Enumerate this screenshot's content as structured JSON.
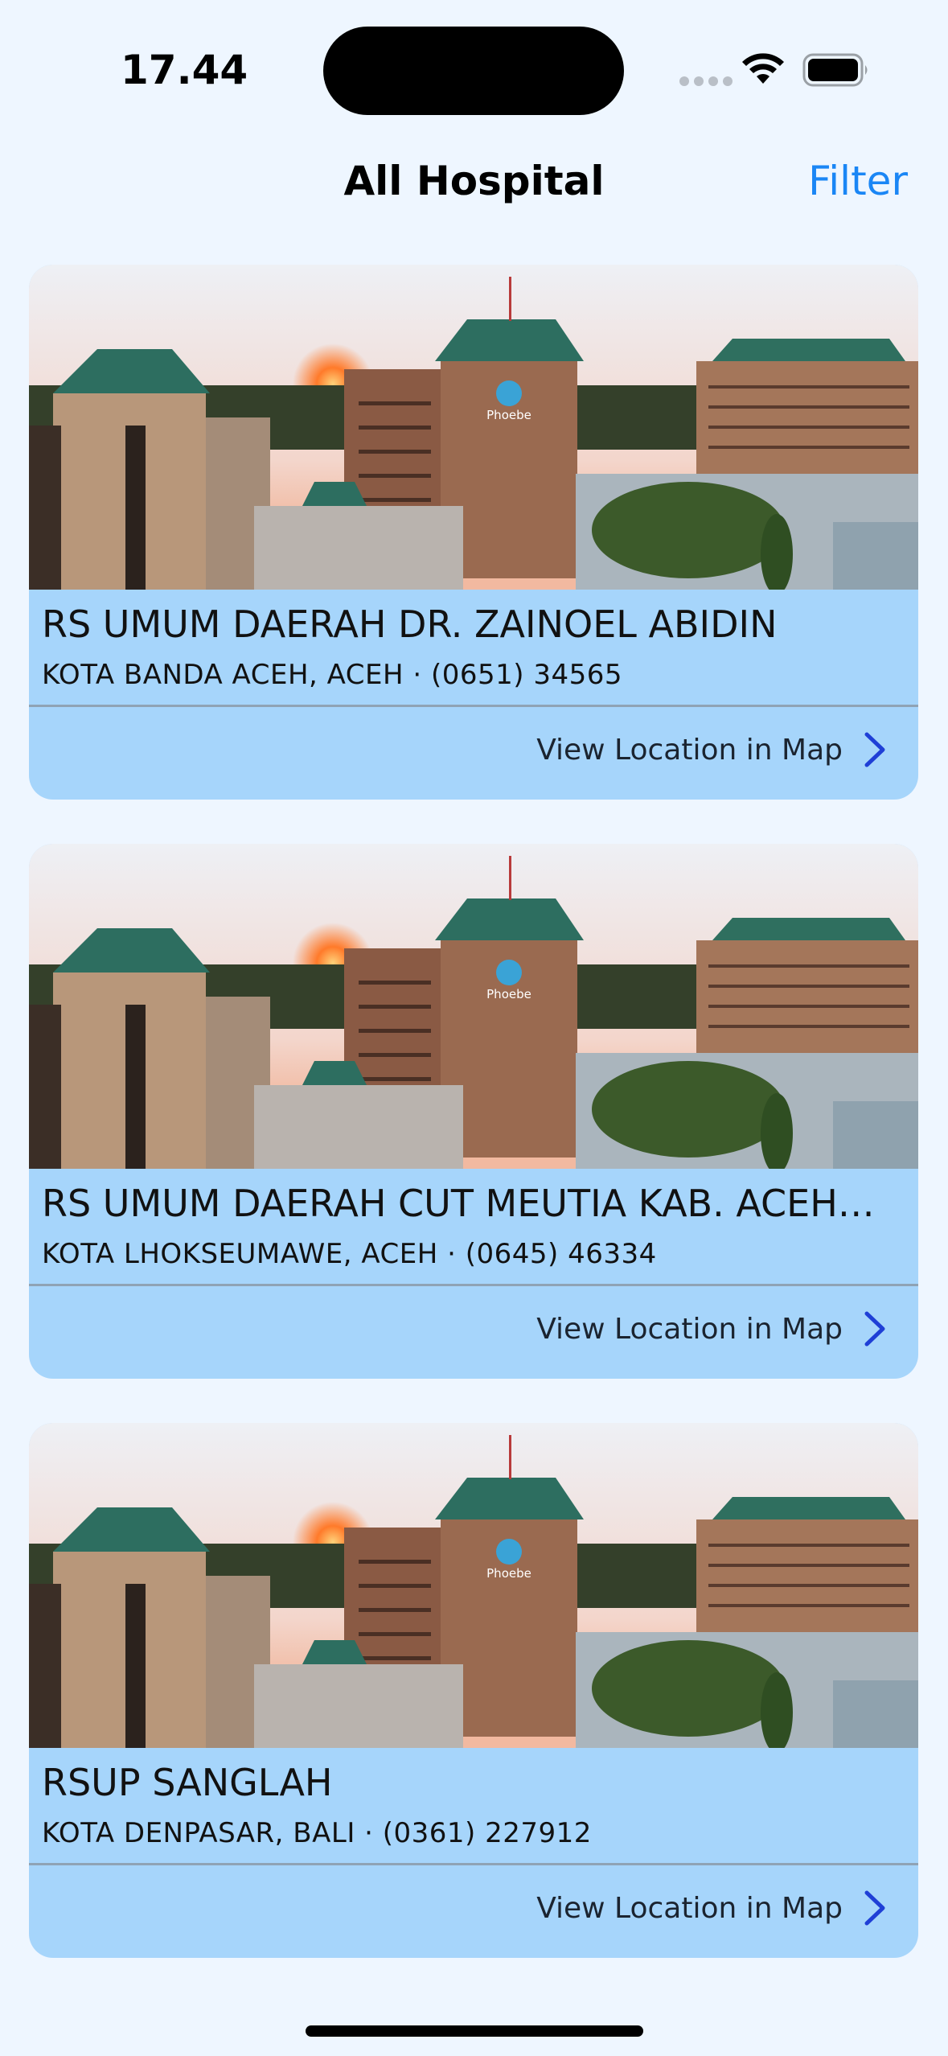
{
  "status_bar": {
    "time": "17.44"
  },
  "nav": {
    "title": "All Hospital",
    "filter_label": "Filter"
  },
  "hospitals": [
    {
      "name": "RS UMUM DAERAH  DR. ZAINOEL ABIDIN",
      "info": "KOTA BANDA ACEH, ACEH · (0651) 34565",
      "map_label": "View Location in Map",
      "sign_text": "Phoebe"
    },
    {
      "name": "RS UMUM DAERAH CUT MEUTIA KAB. ACEH…",
      "info": "KOTA LHOKSEUMAWE, ACEH · (0645) 46334",
      "map_label": "View Location in Map",
      "sign_text": "Phoebe"
    },
    {
      "name": "RSUP SANGLAH",
      "info": "KOTA DENPASAR, BALI · (0361) 227912",
      "map_label": "View Location in Map",
      "sign_text": "Phoebe"
    }
  ],
  "colors": {
    "background": "#eef6ff",
    "card": "#a6d5fb",
    "accent": "#1a86f5",
    "chevron": "#1f3fd6"
  },
  "icons": {
    "wifi": "wifi-icon",
    "battery": "battery-icon",
    "chevron": "chevron-right-icon"
  }
}
